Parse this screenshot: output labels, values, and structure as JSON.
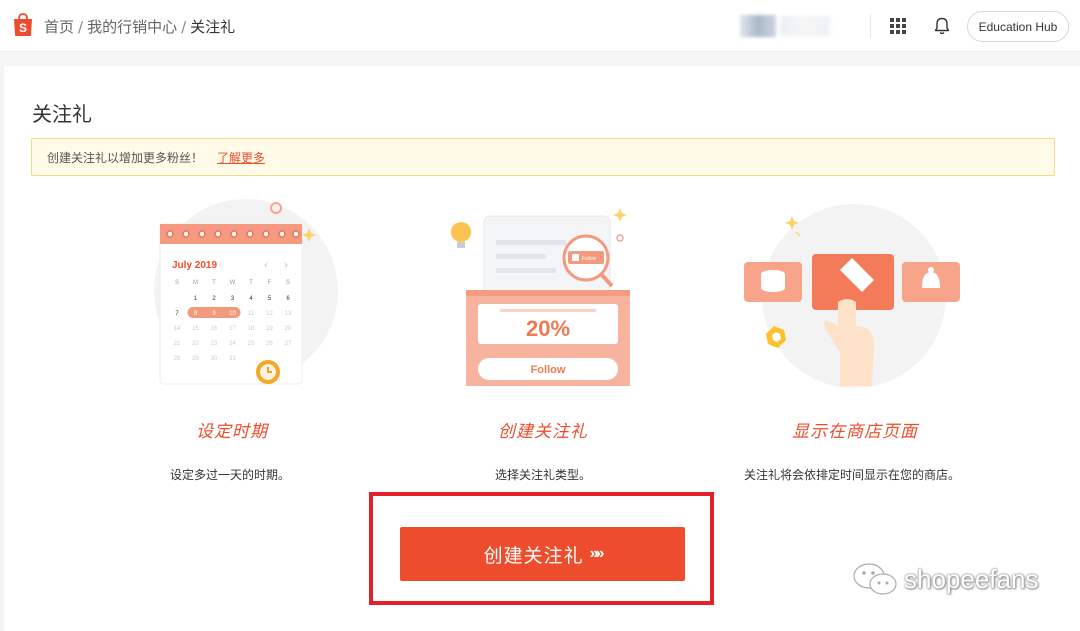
{
  "header": {
    "breadcrumb": {
      "home": "首页",
      "center": "我的行销中心",
      "current": "关注礼"
    },
    "education_hub": "Education Hub"
  },
  "page": {
    "title": "关注礼",
    "notice": {
      "text": "创建关注礼以增加更多粉丝！",
      "link": "了解更多"
    }
  },
  "steps": [
    {
      "title": "设定时期",
      "desc": "设定多过一天的时期。"
    },
    {
      "title": "创建关注礼",
      "desc": "选择关注礼类型。"
    },
    {
      "title": "显示在商店页面",
      "desc": "关注礼将会依排定时间显示在您的商店。"
    }
  ],
  "illustrations": {
    "calendar": {
      "month": "July 2019",
      "weekdays": [
        "S",
        "M",
        "T",
        "W",
        "T",
        "F",
        "S"
      ],
      "rows": [
        [
          "",
          "1",
          "2",
          "3",
          "4",
          "5",
          "6"
        ],
        [
          "7",
          "8",
          "9",
          "10",
          "11",
          "12",
          "13"
        ],
        [
          "14",
          "15",
          "16",
          "17",
          "18",
          "19",
          "20"
        ],
        [
          "21",
          "22",
          "23",
          "24",
          "25",
          "26",
          "27"
        ],
        [
          "28",
          "29",
          "30",
          "31",
          "",
          "",
          ""
        ]
      ]
    },
    "voucher": {
      "percent": "20%",
      "follow": "Follow",
      "tag": "Follow"
    }
  },
  "cta": {
    "label": "创建关注礼",
    "arrows": "»»"
  },
  "watermark": "shopeefans",
  "colors": {
    "brand": "#ee4d2d",
    "notice_bg": "#fffbe8",
    "highlight": "#e5202b"
  }
}
